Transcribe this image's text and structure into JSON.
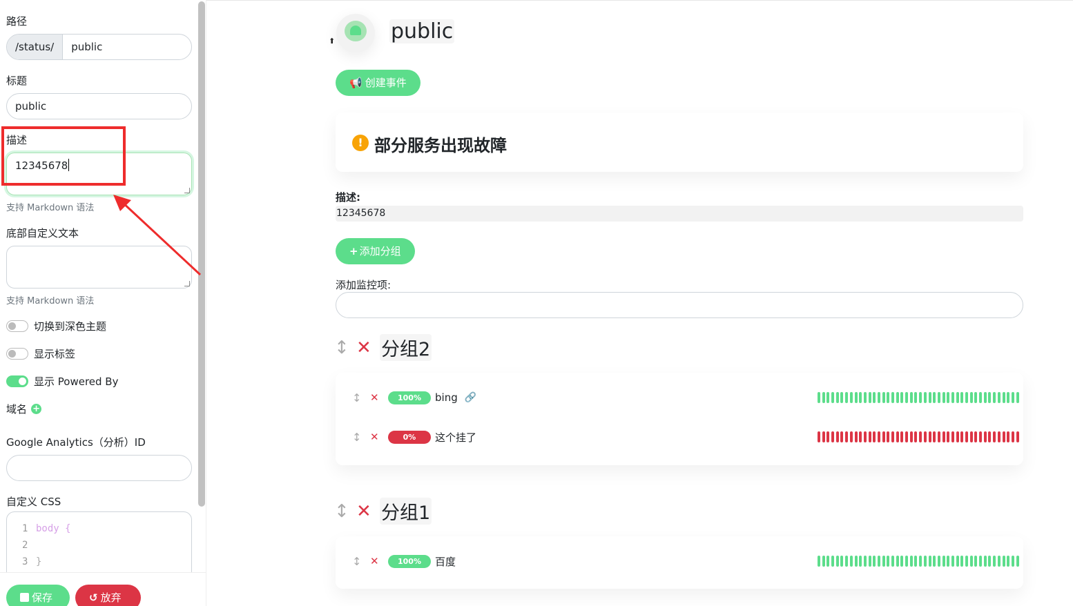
{
  "sidebar": {
    "path_label": "路径",
    "path_prefix": "/status/",
    "path_value": "public",
    "title_label": "标题",
    "title_value": "public",
    "desc_label": "描述",
    "desc_value": "12345678",
    "desc_hint": "支持 Markdown 语法",
    "footer_label": "底部自定义文本",
    "footer_value": "",
    "footer_hint": "支持 Markdown 语法",
    "toggles": [
      {
        "label": "切换到深色主题",
        "on": false
      },
      {
        "label": "显示标签",
        "on": false
      },
      {
        "label": "显示 Powered By",
        "on": true
      }
    ],
    "domain_label": "域名",
    "ga_label": "Google Analytics（分析）ID",
    "ga_value": "",
    "css_label": "自定义 CSS",
    "css_lines": [
      {
        "num": "1",
        "code": "body {"
      },
      {
        "num": "2",
        "code": ""
      },
      {
        "num": "3",
        "code": "}"
      }
    ],
    "save_label": "保存",
    "discard_label": "放弃"
  },
  "main": {
    "title": "public",
    "create_incident_label": "创建事件",
    "incident_title": "部分服务出现故障",
    "desc_label": "描述:",
    "desc_value": "12345678",
    "add_group_label": "添加分组",
    "add_monitor_label": "添加监控项:",
    "groups": [
      {
        "name": "分组2",
        "monitors": [
          {
            "uptime": "100%",
            "name": "bing",
            "status": "up",
            "has_link": true
          },
          {
            "uptime": "0%",
            "name": "这个挂了",
            "status": "down",
            "has_link": false
          }
        ]
      },
      {
        "name": "分组1",
        "monitors": [
          {
            "uptime": "100%",
            "name": "百度",
            "status": "up",
            "has_link": false
          }
        ]
      }
    ]
  },
  "colors": {
    "accent": "#5cdd8b",
    "danger": "#dc3545",
    "warning": "#f8a306",
    "annotation": "#ee2c2c"
  },
  "heartbeat_count": 44
}
